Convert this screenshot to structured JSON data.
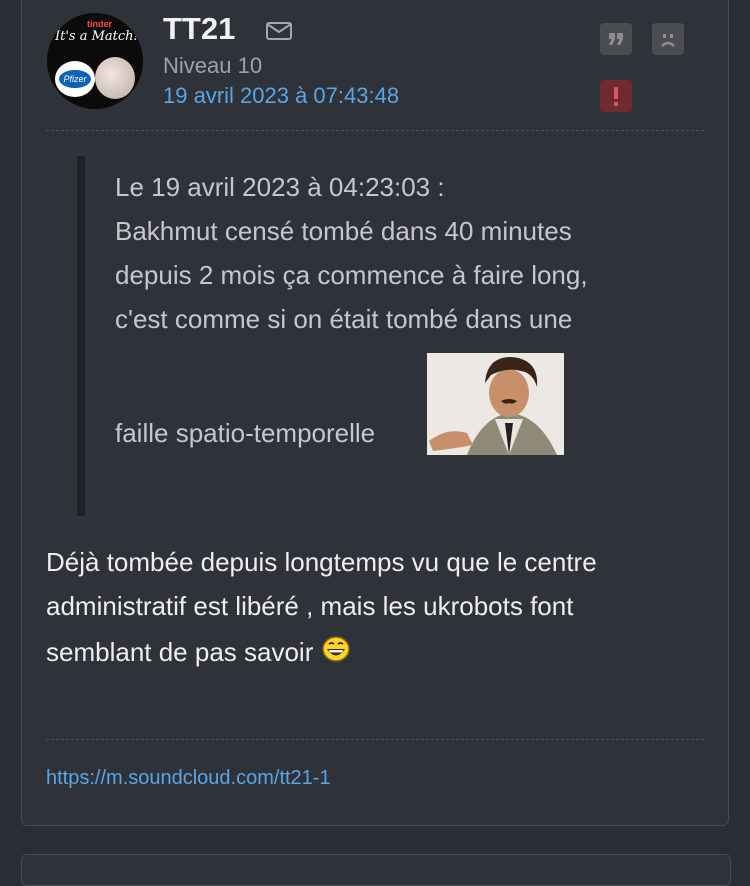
{
  "author": {
    "username": "TT21",
    "level": "Niveau 10",
    "date": "19 avril 2023 à 07:43:48"
  },
  "avatar": {
    "brand_text": "tinder",
    "match_text": "It's a Match!",
    "pfizer_text": "Pfizer"
  },
  "quote": {
    "header": "Le 19 avril 2023 à 04:23:03 :",
    "lines": [
      "Bakhmut censé tombé dans 40 minutes",
      "depuis 2 mois ça commence à faire long,",
      "c'est comme si on était tombé dans une",
      "faille spatio-temporelle"
    ]
  },
  "reply": {
    "lines": [
      "Déjà tombée depuis longtemps vu que le centre",
      "administratif est libéré , mais les ukrobots font",
      "semblant de pas savoir"
    ]
  },
  "signature": {
    "link": "https://m.soundcloud.com/tt21-1"
  },
  "icons": {
    "mail": "envelope-icon",
    "quote": "quote-icon",
    "sad": "sad-face-icon",
    "report": "exclamation-icon",
    "emoji": "laughing-emoji"
  },
  "colors": {
    "link": "#59a6e6",
    "report": "#6e2a2d",
    "background": "#303239"
  }
}
